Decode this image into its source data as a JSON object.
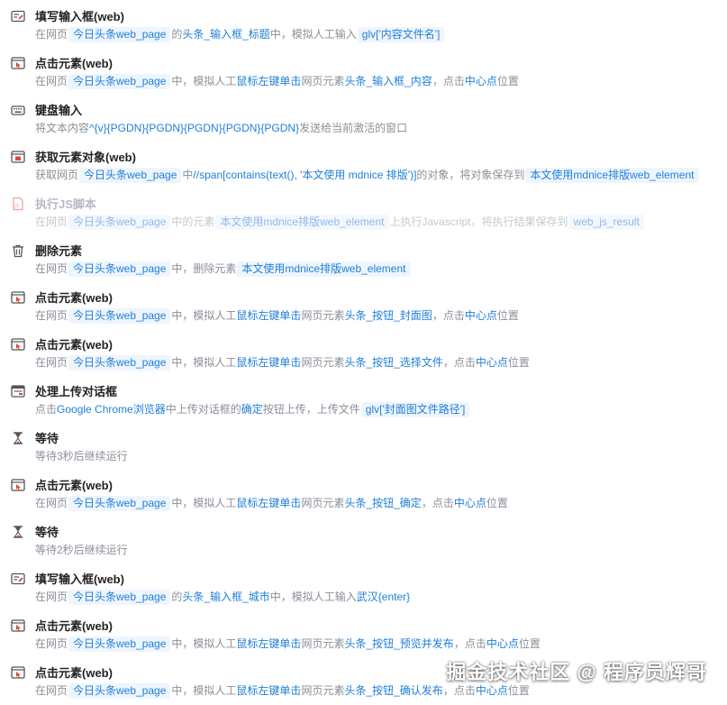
{
  "steps": [
    {
      "title": "填写输入框(web)",
      "icon": "input-fill-icon",
      "disabled": false,
      "desc": [
        {
          "t": "在网页"
        },
        {
          "t": "今日头条web_page",
          "chip": true
        },
        {
          "t": "的"
        },
        {
          "t": "头条_输入框_标题",
          "hl": true
        },
        {
          "t": "中，模拟人工输入"
        },
        {
          "t": "glv['内容文件名']",
          "chip": true
        }
      ]
    },
    {
      "title": "点击元素(web)",
      "icon": "click-element-icon",
      "disabled": false,
      "desc": [
        {
          "t": "在网页"
        },
        {
          "t": "今日头条web_page",
          "chip": true
        },
        {
          "t": "中，模拟人工"
        },
        {
          "t": "鼠标左键单击",
          "hl": true
        },
        {
          "t": "网页元素"
        },
        {
          "t": "头条_输入框_内容",
          "hl": true
        },
        {
          "t": "，点击"
        },
        {
          "t": "中心点",
          "hl": true
        },
        {
          "t": "位置"
        }
      ]
    },
    {
      "title": "键盘输入",
      "icon": "keyboard-icon",
      "disabled": false,
      "desc": [
        {
          "t": "将文本内容"
        },
        {
          "t": "^{v}{PGDN}{PGDN}{PGDN}{PGDN}{PGDN}",
          "hl": true
        },
        {
          "t": "发送给当前激活的窗口"
        }
      ]
    },
    {
      "title": "获取元素对象(web)",
      "icon": "get-element-icon",
      "disabled": false,
      "desc": [
        {
          "t": "获取网页"
        },
        {
          "t": "今日头条web_page",
          "chip": true
        },
        {
          "t": "中"
        },
        {
          "t": "//span[contains(text(), '本文使用 mdnice 排版')]",
          "hl": true
        },
        {
          "t": "的对象，将对象保存到"
        },
        {
          "t": "本文使用mdnice排版web_element",
          "chip": true
        }
      ]
    },
    {
      "title": "执行JS脚本",
      "icon": "js-script-icon",
      "disabled": true,
      "desc": [
        {
          "t": "在网页"
        },
        {
          "t": "今日头条web_page",
          "chip": true
        },
        {
          "t": "中的元素"
        },
        {
          "t": "本文使用mdnice排版web_element",
          "chip": true
        },
        {
          "t": "上执行Javascript，将执行结果保存到"
        },
        {
          "t": "web_js_result",
          "chip": true
        }
      ]
    },
    {
      "title": "删除元素",
      "icon": "trash-icon",
      "disabled": false,
      "desc": [
        {
          "t": "在网页"
        },
        {
          "t": "今日头条web_page",
          "chip": true
        },
        {
          "t": "中，删除元素"
        },
        {
          "t": "本文使用mdnice排版web_element",
          "chip": true
        }
      ]
    },
    {
      "title": "点击元素(web)",
      "icon": "click-element-icon",
      "disabled": false,
      "desc": [
        {
          "t": "在网页"
        },
        {
          "t": "今日头条web_page",
          "chip": true
        },
        {
          "t": "中，模拟人工"
        },
        {
          "t": "鼠标左键单击",
          "hl": true
        },
        {
          "t": "网页元素"
        },
        {
          "t": "头条_按钮_封面图",
          "hl": true
        },
        {
          "t": "，点击"
        },
        {
          "t": "中心点",
          "hl": true
        },
        {
          "t": "位置"
        }
      ]
    },
    {
      "title": "点击元素(web)",
      "icon": "click-element-icon",
      "disabled": false,
      "desc": [
        {
          "t": "在网页"
        },
        {
          "t": "今日头条web_page",
          "chip": true
        },
        {
          "t": "中，模拟人工"
        },
        {
          "t": "鼠标左键单击",
          "hl": true
        },
        {
          "t": "网页元素"
        },
        {
          "t": "头条_按钮_选择文件",
          "hl": true
        },
        {
          "t": "，点击"
        },
        {
          "t": "中心点",
          "hl": true
        },
        {
          "t": "位置"
        }
      ]
    },
    {
      "title": "处理上传对话框",
      "icon": "upload-dialog-icon",
      "disabled": false,
      "desc": [
        {
          "t": "点击"
        },
        {
          "t": "Google Chrome浏览器",
          "hl": true
        },
        {
          "t": "中上传对话框的"
        },
        {
          "t": "确定",
          "hl": true
        },
        {
          "t": "按钮上传，上传文件"
        },
        {
          "t": "glv['封面图文件路径']",
          "chip": true
        }
      ]
    },
    {
      "title": "等待",
      "icon": "hourglass-icon",
      "disabled": false,
      "desc": [
        {
          "t": "等待3秒后继续运行"
        }
      ]
    },
    {
      "title": "点击元素(web)",
      "icon": "click-element-icon",
      "disabled": false,
      "desc": [
        {
          "t": "在网页"
        },
        {
          "t": "今日头条web_page",
          "chip": true
        },
        {
          "t": "中，模拟人工"
        },
        {
          "t": "鼠标左键单击",
          "hl": true
        },
        {
          "t": "网页元素"
        },
        {
          "t": "头条_按钮_确定",
          "hl": true
        },
        {
          "t": "，点击"
        },
        {
          "t": "中心点",
          "hl": true
        },
        {
          "t": "位置"
        }
      ]
    },
    {
      "title": "等待",
      "icon": "hourglass-icon",
      "disabled": false,
      "desc": [
        {
          "t": "等待2秒后继续运行"
        }
      ]
    },
    {
      "title": "填写输入框(web)",
      "icon": "input-fill-icon",
      "disabled": false,
      "desc": [
        {
          "t": "在网页"
        },
        {
          "t": "今日头条web_page",
          "chip": true
        },
        {
          "t": "的"
        },
        {
          "t": "头条_输入框_城市",
          "hl": true
        },
        {
          "t": "中，模拟人工输入"
        },
        {
          "t": "武汉{enter}",
          "hl": true
        }
      ]
    },
    {
      "title": "点击元素(web)",
      "icon": "click-element-icon",
      "disabled": false,
      "desc": [
        {
          "t": "在网页"
        },
        {
          "t": "今日头条web_page",
          "chip": true
        },
        {
          "t": "中，模拟人工"
        },
        {
          "t": "鼠标左键单击",
          "hl": true
        },
        {
          "t": "网页元素"
        },
        {
          "t": "头条_按钮_预览并发布",
          "hl": true
        },
        {
          "t": "，点击"
        },
        {
          "t": "中心点",
          "hl": true
        },
        {
          "t": "位置"
        }
      ]
    },
    {
      "title": "点击元素(web)",
      "icon": "click-element-icon",
      "disabled": false,
      "desc": [
        {
          "t": "在网页"
        },
        {
          "t": "今日头条web_page",
          "chip": true
        },
        {
          "t": "中，模拟人工"
        },
        {
          "t": "鼠标左键单击",
          "hl": true
        },
        {
          "t": "网页元素"
        },
        {
          "t": "头条_按钮_确认发布",
          "hl": true
        },
        {
          "t": "，点击"
        },
        {
          "t": "中心点",
          "hl": true
        },
        {
          "t": "位置"
        }
      ]
    }
  ],
  "watermark": "掘金技术社区 @ 程序员辉哥",
  "colors": {
    "accent": "#1f7fd8",
    "chip_bg": "#eef5fd",
    "icon_red": "#d9463b",
    "icon_dark": "#555555"
  }
}
